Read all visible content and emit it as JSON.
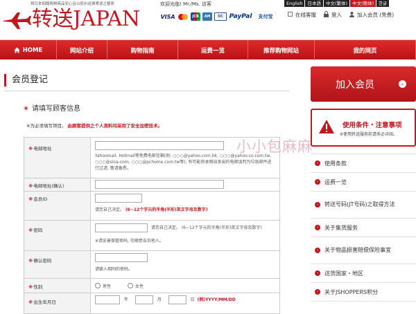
{
  "header": {
    "tagline": "将日本网路购物商品安心且以低价运费寄送之服务",
    "logo_text": "转送JAPAN",
    "welcome": "欢迎光临! Mr./Ms. 访客",
    "payments": {
      "visa": "VISA",
      "paypal": "PayPal",
      "other": "支付宝"
    },
    "languages": [
      {
        "label": "English",
        "active": false
      },
      {
        "label": "日本語",
        "active": false
      },
      {
        "label": "中文(繁体)",
        "active": false
      },
      {
        "label": "中文(簡体)",
        "active": true
      },
      {
        "label": "한글",
        "active": false
      }
    ],
    "links": {
      "support": "在线客服",
      "login": "登入",
      "join": "加入会员 (免费)"
    }
  },
  "nav": [
    {
      "label": "HOME",
      "icon": "home-icon"
    },
    {
      "label": "网站介绍"
    },
    {
      "label": "购物指南"
    },
    {
      "label": "运费一览"
    },
    {
      "label": "推荐购物网站"
    },
    {
      "label": "我的网页"
    }
  ],
  "main": {
    "page_title": "会员登记",
    "section_title": "请填写顾客信息",
    "required_note": "※为必须填写项目。",
    "privacy_note": "由顾客提供之个人资料均采用了安全加密技术。",
    "form": {
      "email": {
        "label": "电邮地址",
        "hint": "Yahoomail, Hotmail等免费电邮信箱(例: ○○○@yahoo.com.hk, ○○○@yahoo.co.com.tw, ○○○@sina.com, ○○○@pchome.com.tw等), 有可能将本网站发出的电邮误判为垃圾邮件进行过滤, 敬请备悉。"
      },
      "email_confirm": {
        "label": "电邮地址(确认)"
      },
      "member_id": {
        "label": "会员ID",
        "hint_prefix": "请您自己决定。",
        "hint_red": "(6~12个字元的半角(半形)英文字母及数字)"
      },
      "password": {
        "label": "密码",
        "hint_inline": "请您自己决定。 (6~12个字元的半角(半形)英文字母及数字)",
        "hint": "※请妥善保管密码, 勿随意告诉他人。"
      },
      "password_confirm": {
        "label": "确认密码",
        "hint": "请输入相同的密码。"
      },
      "gender": {
        "label": "性别",
        "male": "男性",
        "female": "女性"
      },
      "birthdate": {
        "label": "出生年月日",
        "year": "年",
        "month": "月",
        "day": "日",
        "format": "(例)YYYY/MM/DD"
      }
    }
  },
  "aside": {
    "join_button": "加入会员",
    "terms_title": "使用条件・注意事项",
    "terms_note": "※使用转送服务前请务必详阅。",
    "menu": [
      "使用条款",
      "运费一览",
      "转送号码(JT号码)之取得方法",
      "关于集货服务",
      "关于物品损害赔偿保险事宜",
      "送货国家・地区",
      "关于JSHOPPERS积分"
    ]
  },
  "watermark": "小小包麻麻",
  "colors": {
    "brand_red": "#c0181e",
    "nav_red": "#d4201f"
  }
}
